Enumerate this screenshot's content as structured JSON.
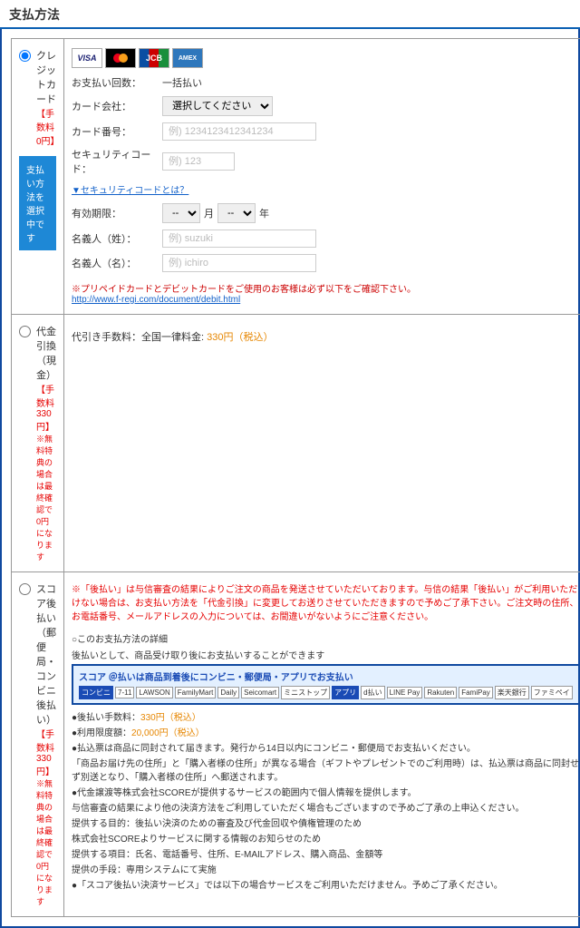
{
  "title": "支払方法",
  "left": {
    "credit": {
      "label": "クレジットカード",
      "fee": "【手数料0円】",
      "activeBtn": "支払い方法を選択中です"
    },
    "cod": {
      "label": "代金引換（現金）",
      "fee": "【手数料330円】",
      "note": "※無料特典の場合は最終確認で0円になります"
    },
    "later": {
      "label": "スコア後払い（郵便局・コンビニ後払い）",
      "fee": "【手数料330円】",
      "note": "※無料特典の場合は最終確認で0円になります"
    }
  },
  "credit": {
    "logos": {
      "visa": "VISA",
      "jcb": "JCB",
      "amex": "AMEX"
    },
    "payCountLbl": "お支払い回数：",
    "payCountVal": "一括払い",
    "companyLbl": "カード会社：",
    "companyOpt": "選択してください",
    "cardNoLbl": "カード番号：",
    "cardNoPh": "例) 1234123412341234",
    "secLbl": "セキュリティコード：",
    "secPh": "例) 123",
    "secLink": "▼セキュリティコードとは？",
    "expLbl": "有効期限：",
    "expMonth": "--",
    "expMUnit": "月",
    "expYear": "--",
    "expYUnit": "年",
    "lastNameLbl": "名義人（姓）：",
    "lastNamePh": "例) suzuki",
    "firstNameLbl": "名義人（名）：",
    "firstNamePh": "例) ichiro",
    "prepaidNote": "※プリペイドカードとデビットカードをご使用のお客様は必ず以下をご確認下さい。",
    "prepaidUrl": "http://www.f-regi.com/document/debit.html"
  },
  "cod": {
    "feeLabel": "代引き手数料：全国一律料金:",
    "feeValue": "330円（税込）"
  },
  "later": {
    "warn": "※「後払い」は与信審査の結果によりご注文の商品を発送させていただいております。与信の結果「後払い」がご利用いただけない場合は、お支払い方法を「代金引換」に変更してお送りさせていただきますので予めご了承下さい。ご注文時の住所、お電話番号、メールアドレスの入力については、お間違いがないようにご注意ください。",
    "subHead": "○このお支払方法の詳細",
    "subDesc": "後払いとして、商品受け取り後にお支払いすることができます",
    "bannerHead": "スコア ＠払いは商品到着後にコンビニ・郵便局・アプリでお支払い",
    "bannerLogos": [
      "コンビニ",
      "7-11",
      "LAWSON",
      "FamilyMart",
      "Daily",
      "Seicomart",
      "ミニストップ",
      "アプリ",
      "d払い",
      "LINE Pay",
      "Rakuten",
      "FamiPay",
      "楽天銀行",
      "ファミペイ"
    ],
    "lines": [
      {
        "pre": "●後払い手数料：",
        "val": "330円（税込）",
        "orange": true
      },
      {
        "pre": "●利用限度額：",
        "val": "20,000円（税込）",
        "orange": true
      },
      {
        "pre": "●払込票は商品に同封されて届きます。発行から14日以内にコンビニ・郵便局でお支払いください。"
      },
      {
        "pre": "「商品お届け先の住所」と「購入者様の住所」が異なる場合（ギフトやプレゼントでのご利用時）は、払込票は商品に同封せず別送となり、「購入者様の住所」へ郵送されます。"
      },
      {
        "pre": "●代金譲渡等株式会社SCOREが提供するサービスの範囲内で個人情報を提供します。"
      },
      {
        "pre": "与信審査の結果により他の決済方法をご利用していただく場合もございますので予めご了承の上申込ください。"
      },
      {
        "pre": "提供する目的：後払い決済のための審査及び代金回収や債権管理のため"
      },
      {
        "pre": "株式会社SCOREよりサービスに関する情報のお知らせのため"
      },
      {
        "pre": "提供する項目：氏名、電話番号、住所、E‑MAILアドレス、購入商品、金額等"
      },
      {
        "pre": "提供の手段：専用システムにて実施"
      },
      {
        "pre": "●「スコア後払い決済サービス」では以下の場合サービスをご利用いただけません。予めご了承ください。"
      }
    ]
  }
}
